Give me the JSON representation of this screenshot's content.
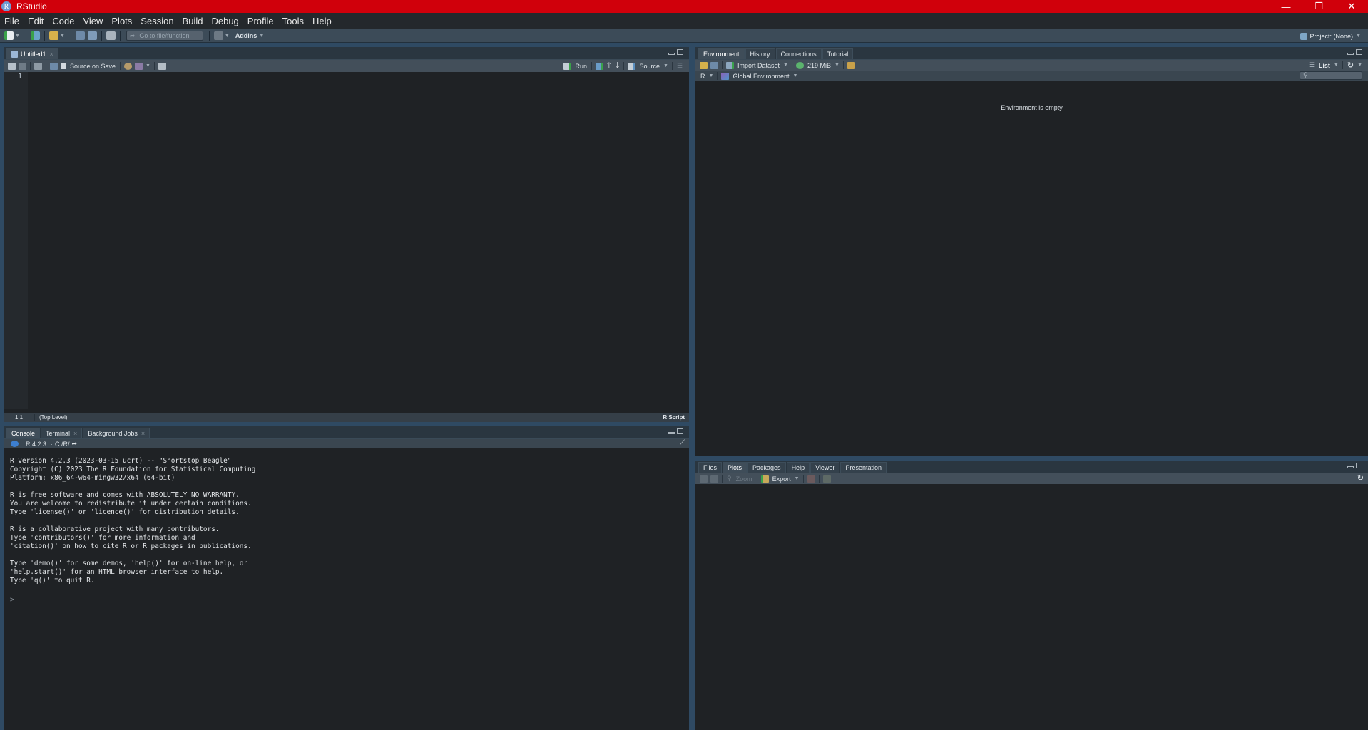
{
  "window": {
    "title": "RStudio",
    "logo_letter": "R",
    "controls": {
      "minimize": "—",
      "restore": "❐",
      "close": "✕"
    }
  },
  "menu": [
    "File",
    "Edit",
    "Code",
    "View",
    "Plots",
    "Session",
    "Build",
    "Debug",
    "Profile",
    "Tools",
    "Help"
  ],
  "toolbar": {
    "goto_placeholder": "Go to file/function",
    "addins_label": "Addins",
    "project_label": "Project: (None)"
  },
  "editor": {
    "tabs": [
      {
        "label": "Untitled1",
        "closable": true,
        "active": true
      }
    ],
    "toolbar": {
      "source_on_save_label": "Source on Save",
      "source_on_save_checked": false,
      "run_label": "Run",
      "source_label": "Source"
    },
    "line_numbers": [
      "1"
    ],
    "content": "",
    "status": {
      "position": "1:1",
      "scope": "(Top Level)",
      "file_type": "R Script"
    }
  },
  "console": {
    "tabs": [
      {
        "label": "Console",
        "active": true,
        "closable": false
      },
      {
        "label": "Terminal",
        "active": false,
        "closable": true
      },
      {
        "label": "Background Jobs",
        "active": false,
        "closable": true
      }
    ],
    "r_version_label": "R 4.2.3",
    "working_dir": "C:/R/",
    "output_lines": [
      "R version 4.2.3 (2023-03-15 ucrt) -- \"Shortstop Beagle\"",
      "Copyright (C) 2023 The R Foundation for Statistical Computing",
      "Platform: x86_64-w64-mingw32/x64 (64-bit)",
      "",
      "R is free software and comes with ABSOLUTELY NO WARRANTY.",
      "You are welcome to redistribute it under certain conditions.",
      "Type 'license()' or 'licence()' for distribution details.",
      "",
      "R is a collaborative project with many contributors.",
      "Type 'contributors()' for more information and",
      "'citation()' on how to cite R or R packages in publications.",
      "",
      "Type 'demo()' for some demos, 'help()' for on-line help, or",
      "'help.start()' for an HTML browser interface to help.",
      "Type 'q()' to quit R."
    ],
    "prompt": ">"
  },
  "environment": {
    "tabs": [
      {
        "label": "Environment",
        "active": true
      },
      {
        "label": "History",
        "active": false
      },
      {
        "label": "Connections",
        "active": false
      },
      {
        "label": "Tutorial",
        "active": false
      }
    ],
    "import_dataset_label": "Import Dataset",
    "memory_label": "219 MiB",
    "view_mode_label": "List",
    "language_label": "R",
    "scope_label": "Global Environment",
    "empty_message": "Environment is empty",
    "search_placeholder": ""
  },
  "files": {
    "tabs": [
      {
        "label": "Files",
        "active": false
      },
      {
        "label": "Plots",
        "active": true
      },
      {
        "label": "Packages",
        "active": false
      },
      {
        "label": "Help",
        "active": false
      },
      {
        "label": "Viewer",
        "active": false
      },
      {
        "label": "Presentation",
        "active": false
      }
    ],
    "zoom_label": "Zoom",
    "export_label": "Export"
  },
  "colors": {
    "titlebar": "#d0000b",
    "menubar": "#24282c",
    "splitter": "#2f4a63",
    "pane_bg": "#1f2225"
  }
}
